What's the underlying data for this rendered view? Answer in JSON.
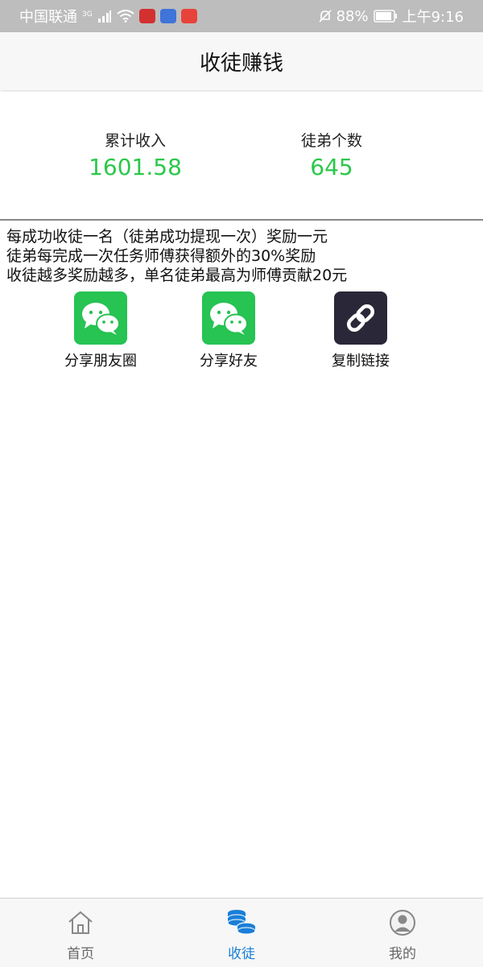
{
  "status_bar": {
    "carrier": "中国联通",
    "network": "3G",
    "battery": "88%",
    "time": "上午9:16",
    "icons": [
      "signal-icon",
      "wifi-icon",
      "app-icon-red",
      "app-icon-blue",
      "app-icon-huawei",
      "mute-icon",
      "battery-icon"
    ]
  },
  "header": {
    "title": "收徒赚钱"
  },
  "stats": {
    "income_label": "累计收入",
    "income_value": "1601.58",
    "apprentice_label": "徒弟个数",
    "apprentice_value": "645"
  },
  "rules": [
    "每成功收徒一名（徒弟成功提现一次）奖励一元",
    "徒弟每完成一次任务师傅获得额外的30%奖励",
    "收徒越多奖励越多，单名徒弟最高为师傅贡献20元"
  ],
  "share": [
    {
      "label": "分享朋友圈",
      "icon": "wechat-icon"
    },
    {
      "label": "分享好友",
      "icon": "wechat-icon"
    },
    {
      "label": "复制链接",
      "icon": "link-icon"
    }
  ],
  "tabs": [
    {
      "label": "首页",
      "icon": "home-icon"
    },
    {
      "label": "收徒",
      "icon": "coins-icon",
      "active": true
    },
    {
      "label": "我的",
      "icon": "profile-icon"
    }
  ],
  "colors": {
    "accent_green": "#2bc84a",
    "wechat_green": "#27c353",
    "active_tab_blue": "#1b7fd8",
    "link_bg": "#2a2838"
  }
}
